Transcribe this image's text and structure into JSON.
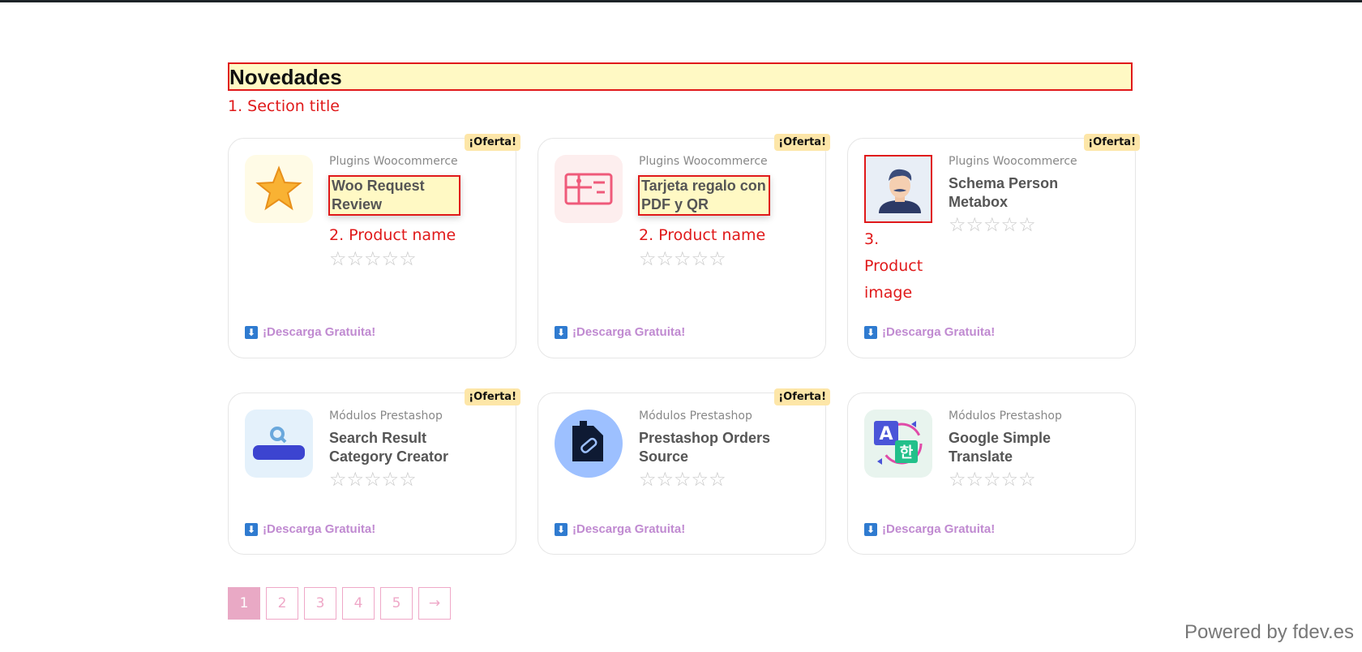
{
  "section": {
    "title": "Novedades",
    "annotation": "1. Section title"
  },
  "products": [
    {
      "badge": "¡Oferta!",
      "category": "Plugins Woocommerce",
      "name": "Woo Request Review",
      "icon": "star-icon",
      "rating": 0,
      "download": "¡Descarga Gratuita!",
      "annotation": "2. Product name"
    },
    {
      "badge": "¡Oferta!",
      "category": "Plugins Woocommerce",
      "name": "Tarjeta regalo con PDF y QR",
      "icon": "gift-card-icon",
      "rating": 0,
      "download": "¡Descarga Gratuita!",
      "annotation": "2. Product name"
    },
    {
      "badge": "¡Oferta!",
      "category": "Plugins Woocommerce",
      "name": "Schema Person Metabox",
      "icon": "person-avatar-icon",
      "rating": 0,
      "download": "¡Descarga Gratuita!",
      "annotation": "3. Product image"
    },
    {
      "badge": "¡Oferta!",
      "category": "Módulos Prestashop",
      "name": "Search Result Category Creator",
      "icon": "search-bar-icon",
      "rating": 0,
      "download": "¡Descarga Gratuita!"
    },
    {
      "badge": "¡Oferta!",
      "category": "Módulos Prestashop",
      "name": "Prestashop Orders Source",
      "icon": "order-tag-icon",
      "rating": 0,
      "download": "¡Descarga Gratuita!"
    },
    {
      "category": "Módulos Prestashop",
      "name": "Google Simple Translate",
      "icon": "translate-icon",
      "rating": 0,
      "download": "¡Descarga Gratuita!"
    }
  ],
  "stars_display": "☆☆☆☆☆",
  "pagination": {
    "pages": [
      "1",
      "2",
      "3",
      "4",
      "5"
    ],
    "next": "→",
    "current": "1"
  },
  "footer": {
    "powered_by": "Powered by fdev.es"
  },
  "colors": {
    "annotation_red": "#e0191a",
    "highlight_yellow": "#fff9c4",
    "badge": "#fde6a8",
    "download_link": "#c08ad1",
    "pagination_pink": "#e9a9c5"
  }
}
